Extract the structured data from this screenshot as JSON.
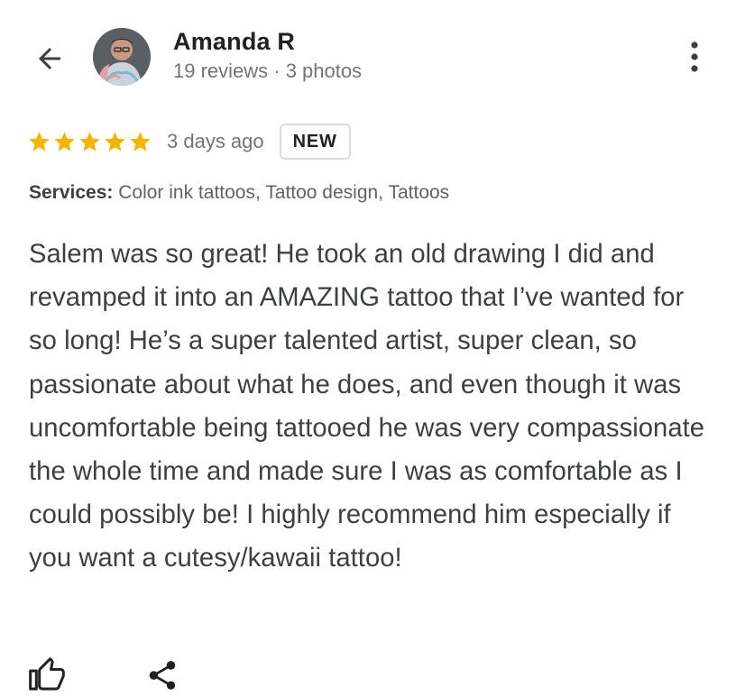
{
  "header": {
    "back_icon": "arrow-back-icon",
    "author_name": "Amanda R",
    "author_meta": "19 reviews · 3 photos",
    "more_icon": "more-vert-icon"
  },
  "review": {
    "rating": 5,
    "rating_max": 5,
    "star_color": "#f4b400",
    "date": "3 days ago",
    "badge": "NEW",
    "services_label": "Services:",
    "services_value": " Color ink tattoos, Tattoo design, Tattoos",
    "text": "Salem was so great! He took an old drawing I did and revamped it into an AMAZING tattoo that I’ve wanted for so long! He’s a super talented artist, super clean, so passionate about what he does, and even though it was uncomfortable being tattooed he was very compassionate the whole time and made sure I was as comfortable as I could possibly be! I highly recommend him especially if you want a cutesy/kawaii tattoo!"
  },
  "actions": {
    "like_icon": "thumb-up-icon",
    "share_icon": "share-icon"
  }
}
